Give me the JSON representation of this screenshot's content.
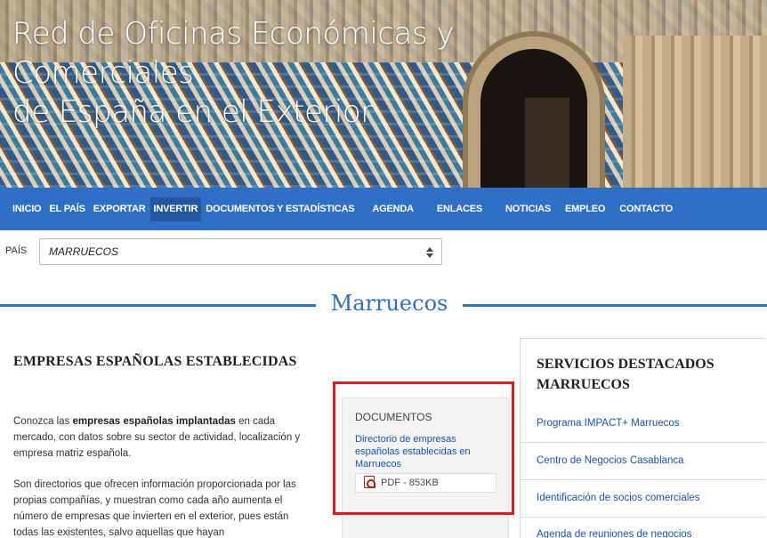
{
  "header": {
    "title_line1": "Red de Oficinas Económicas y Comerciales",
    "title_line2": "de España en el Exterior"
  },
  "nav": {
    "items": [
      {
        "label": "INICIO"
      },
      {
        "label": "EL PAÍS"
      },
      {
        "label": "EXPORTAR"
      },
      {
        "label": "INVERTIR",
        "active": true
      },
      {
        "label": "DOCUMENTOS Y ESTADÍSTICAS"
      },
      {
        "label": "AGENDA"
      },
      {
        "label": "ENLACES"
      },
      {
        "label": "NOTICIAS"
      },
      {
        "label": "EMPLEO"
      },
      {
        "label": "CONTACTO"
      }
    ]
  },
  "country": {
    "label": "PAÍS",
    "selected": "MARRUECOS"
  },
  "section": {
    "title": "Marruecos"
  },
  "main": {
    "heading": "EMPRESAS ESPAÑOLAS ESTABLECIDAS",
    "p1_a": "Conozca las ",
    "p1_b": "empresas españolas implantadas",
    "p1_c": " en cada mercado, con datos sobre su sector de actividad, localización y empresa matriz española.",
    "p2": "Son directorios que ofrecen información proporcionada por las propias compañías, y muestran como cada año aumenta el número de empresas que invierten en el exterior, pues están todas las existentes, salvo aquellas que hayan"
  },
  "documents": {
    "title": "DOCUMENTOS",
    "link": "Directorio de empresas españolas establecidas en Marruecos",
    "file": "PDF - 853KB"
  },
  "sidebar": {
    "title": "SERVICIOS DESTACADOS MARRUECOS",
    "links": [
      {
        "label": "Programa IMPACT+ Marruecos"
      },
      {
        "label": "Centro de Negocios Casablanca"
      },
      {
        "label": "Identificación de socios comerciales"
      },
      {
        "label": "Agenda de reuniones de negocios"
      }
    ]
  },
  "colors": {
    "nav_bg": "#2f6fc7",
    "nav_active": "#23579f",
    "link": "#1f4fb3",
    "highlight": "#e8161d"
  }
}
